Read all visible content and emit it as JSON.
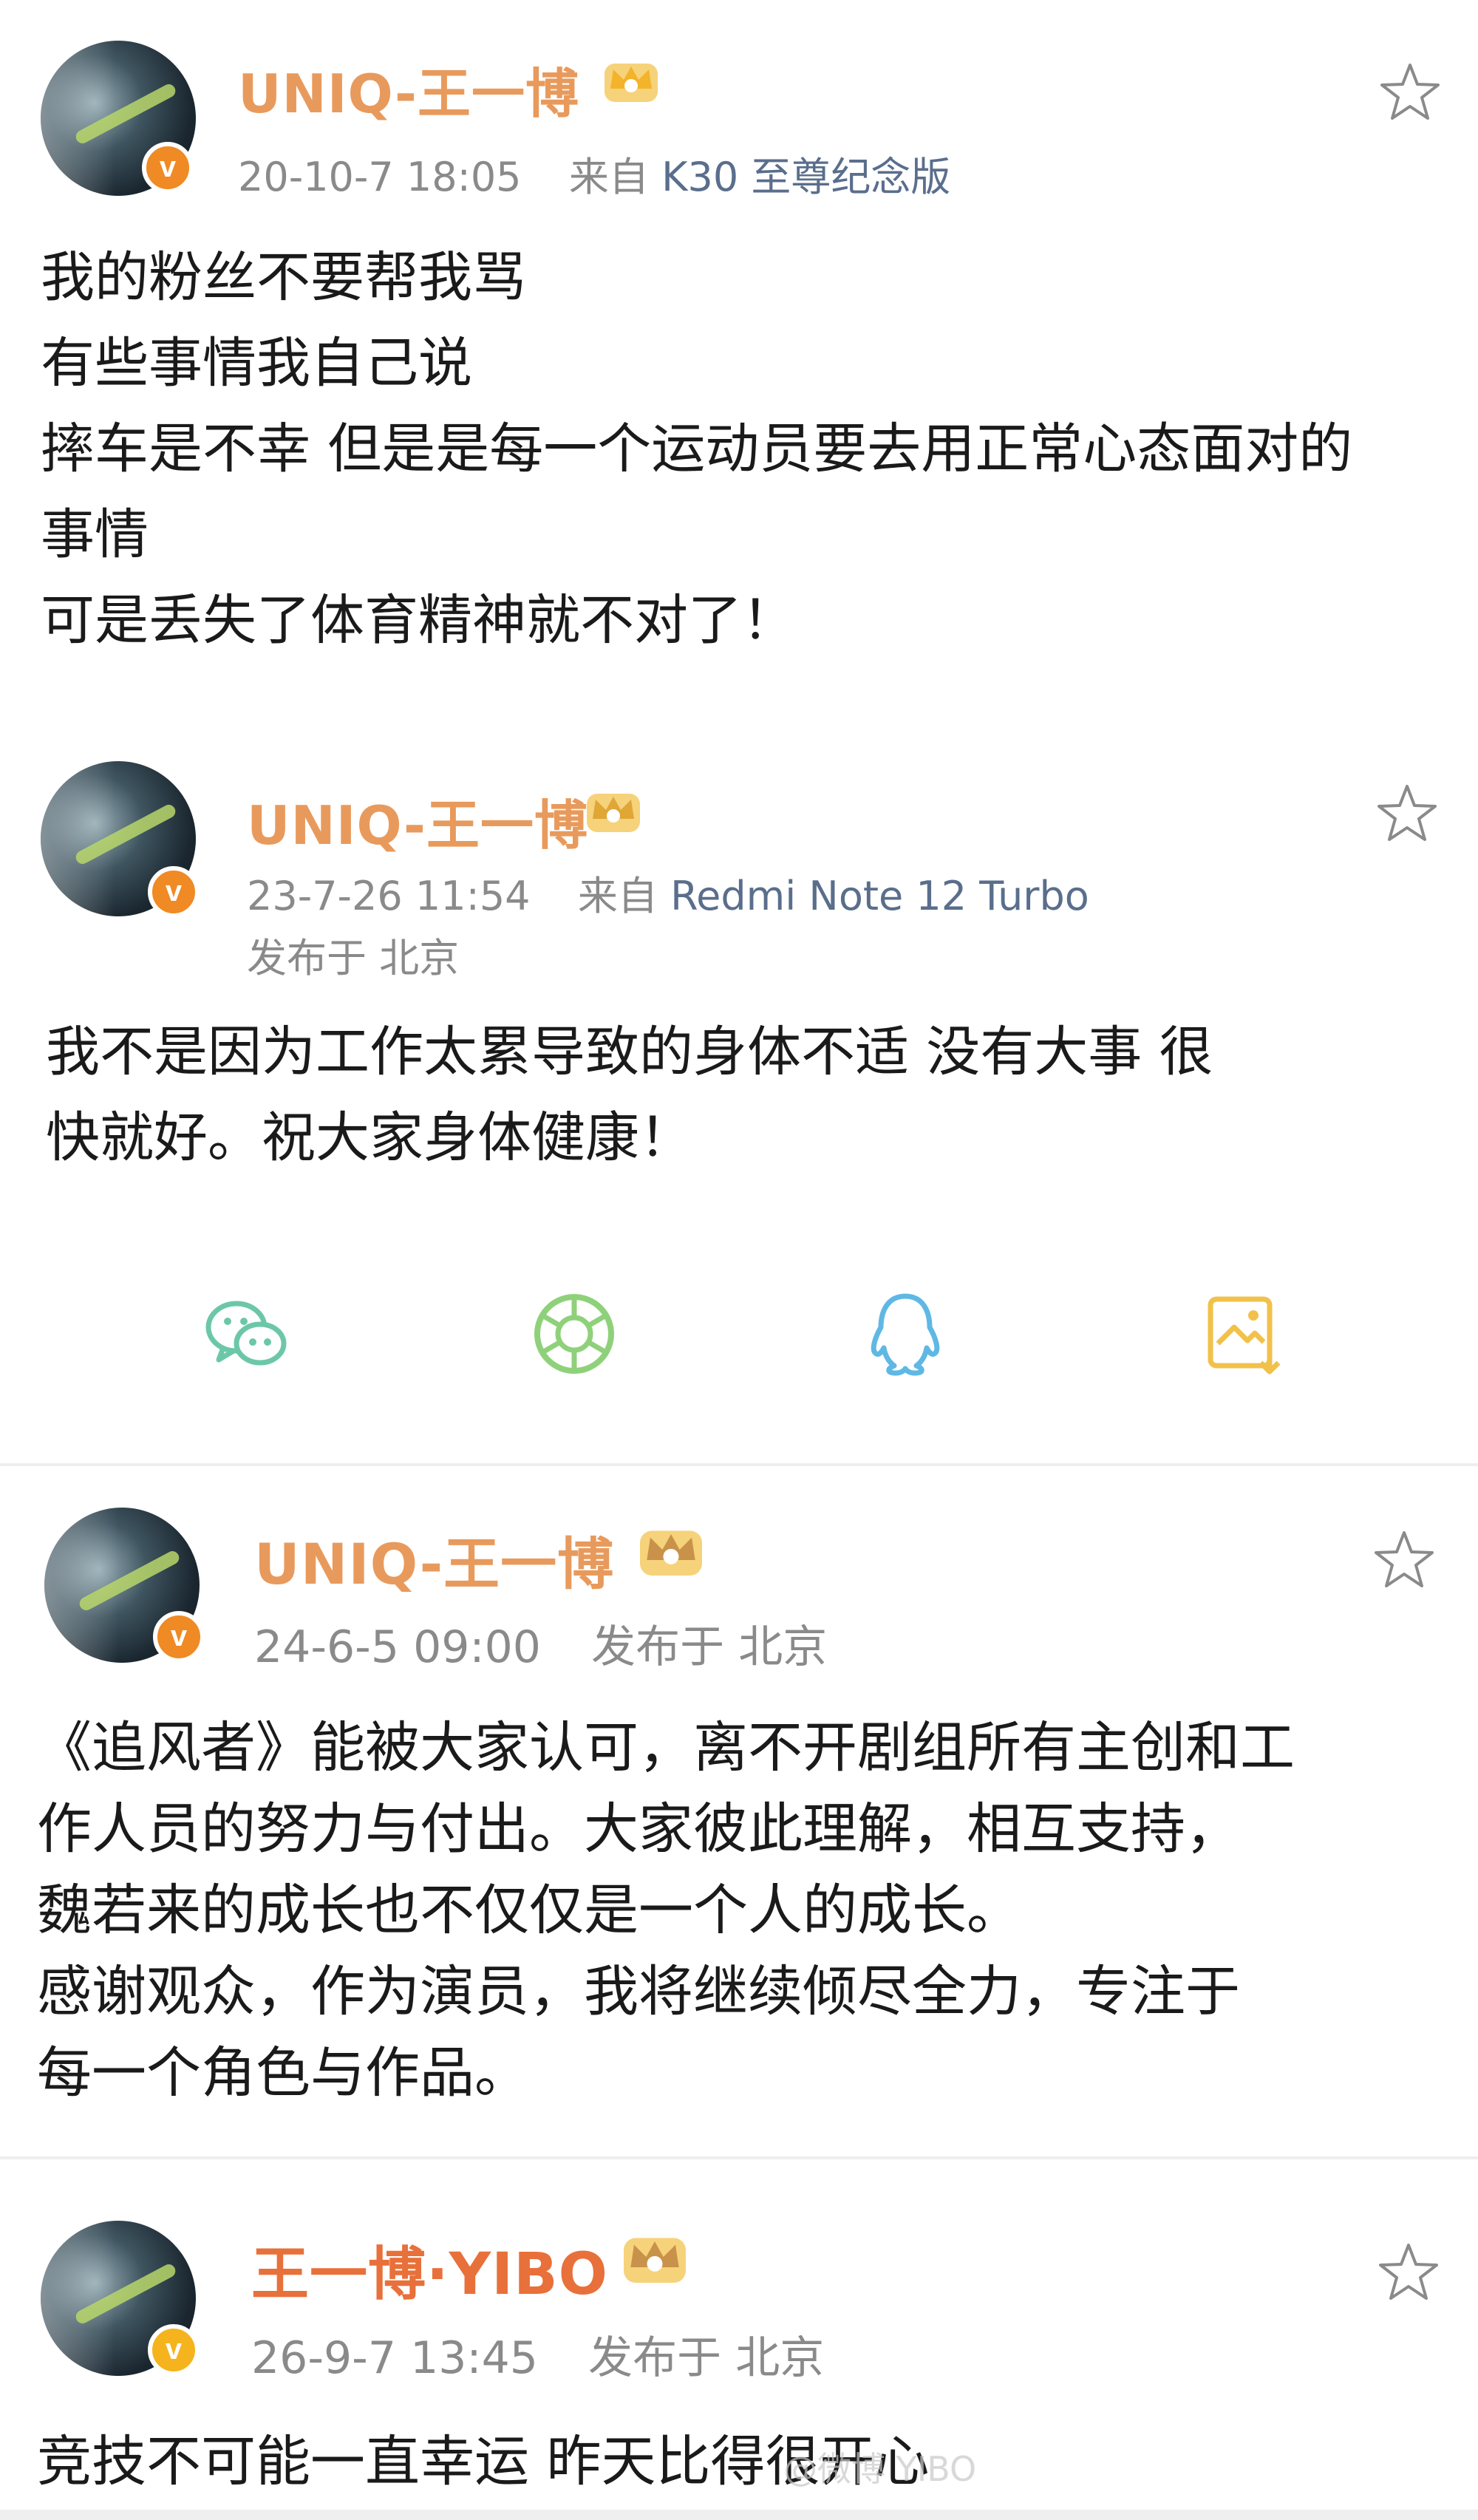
{
  "posts": [
    {
      "username": "UNIQ-王一博",
      "date": "20-10-7 18:05",
      "from": "来自",
      "device": "K30 至尊纪念版",
      "location": "",
      "lines": [
        "我的粉丝不要帮我骂",
        "有些事情我自己说",
        "摔车是不幸 但是是每一个运动员要去用正常心态面对的",
        "事情",
        "可是丢失了体育精神就不对了！"
      ]
    },
    {
      "username": "UNIQ-王一博",
      "date": "23-7-26 11:54",
      "from": "来自",
      "device": "Redmi Note 12 Turbo",
      "location": "发布于 北京",
      "lines": [
        "我不是因为工作太累导致的身体不适 没有大事 很",
        "快就好。祝大家身体健康！"
      ]
    },
    {
      "username": "UNIQ-王一博",
      "date": "24-6-5 09:00",
      "location": "发布于 北京",
      "lines": [
        "《追风者》能被大家认可，离不开剧组所有主创和工",
        "作人员的努力与付出。大家彼此理解，相互支持，",
        "魏若来的成长也不仅仅是一个人的成长。",
        "感谢观众，作为演员，我将继续倾尽全力，专注于",
        "每一个角色与作品。"
      ]
    },
    {
      "username": "王一博·YIBO",
      "date": "26-9-7 13:45",
      "location": "发布于 北京",
      "lines": [
        "竞技不可能一直幸运 昨天比得很开心"
      ]
    }
  ],
  "share_icons": [
    "wechat-icon",
    "moments-icon",
    "qq-icon",
    "save-image-icon"
  ],
  "watermark": "@微博 YIBO",
  "colors": {
    "username": "#e89a5c",
    "badge": "#f08a24",
    "meta": "#8a8a8a"
  }
}
